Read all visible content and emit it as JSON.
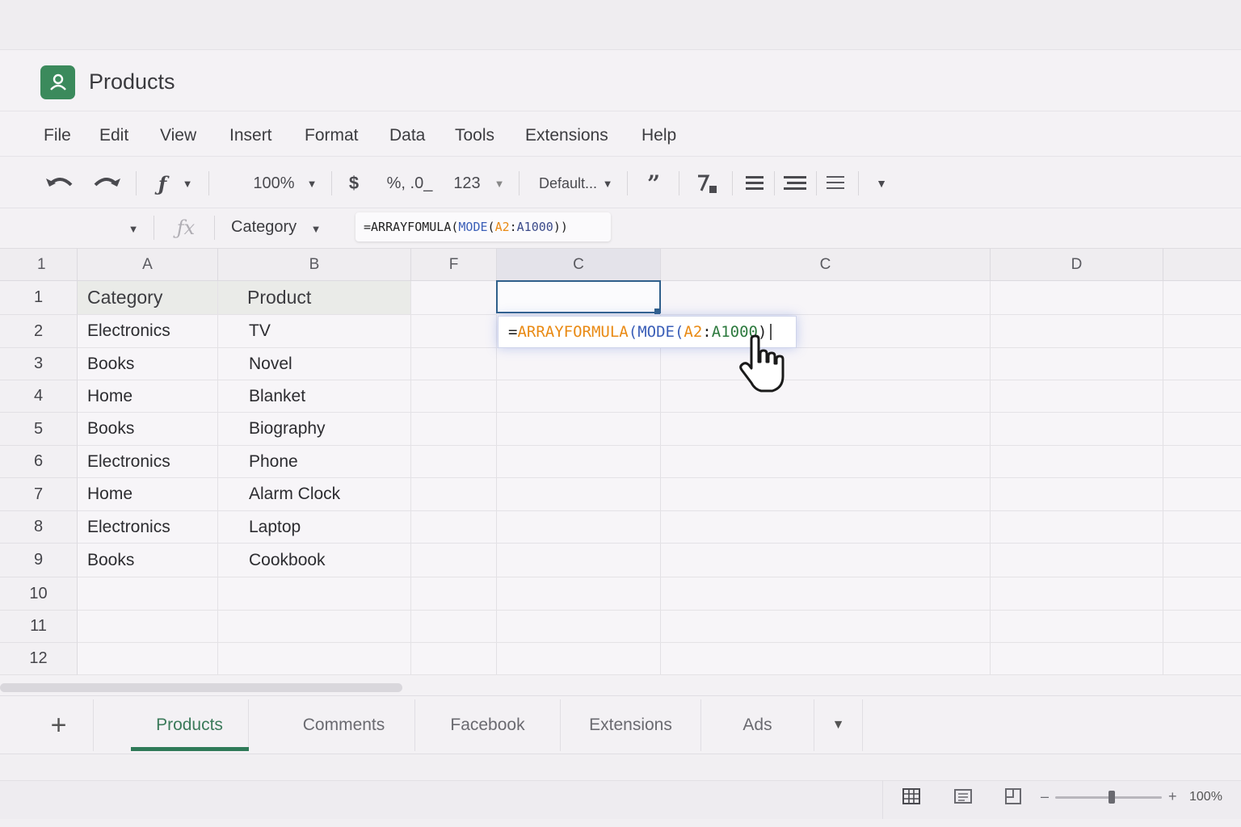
{
  "app": {
    "title": "Products"
  },
  "menu": [
    "File",
    "Edit",
    "View",
    "Insert",
    "Format",
    "Data",
    "Tools",
    "Extensions",
    "Help"
  ],
  "toolbar": {
    "zoom": "100%",
    "currency": "$",
    "percent_decimal": "%, .0_",
    "number_format": "123",
    "font": "Default..."
  },
  "formula_bar": {
    "name_box_value": "Category",
    "formula_eq": "=",
    "formula_fn": "ARRAYFOMULA",
    "formula_open": "(",
    "formula_inner_fn": "MODE",
    "formula_open2": "(",
    "formula_ref1": "A2",
    "formula_colon": ":",
    "formula_ref2": "A1000",
    "formula_close": "))"
  },
  "grid": {
    "corner_label": "1",
    "columns": [
      "A",
      "B",
      "F",
      "C",
      "C",
      "D"
    ],
    "row_numbers": [
      "1",
      "2",
      "3",
      "4",
      "5",
      "6",
      "7",
      "8",
      "9",
      "10",
      "11",
      "12"
    ],
    "rows": [
      [
        "Category",
        "Product"
      ],
      [
        "Electronics",
        "TV"
      ],
      [
        "Books",
        "Novel"
      ],
      [
        "Home",
        "Blanket"
      ],
      [
        "Books",
        "Biography"
      ],
      [
        "Electronics",
        "Phone"
      ],
      [
        "Home",
        "Alarm Clock"
      ],
      [
        "Electronics",
        "Laptop"
      ],
      [
        "Books",
        "Cookbook"
      ]
    ]
  },
  "cell_editor": {
    "eq": "=",
    "fn": "ARRAYFORMULA",
    "open": "(",
    "inner_fn": "MODE",
    "open2": "(",
    "ref1": "A2",
    "colon": ":",
    "ref2": "A1000",
    "close": ")"
  },
  "sheets": [
    "Products",
    "Comments",
    "Facebook",
    "Extensions",
    "Ads"
  ],
  "active_sheet": "Products",
  "status": {
    "zoom": "100%",
    "zoom_slider_level": 0.55
  },
  "colors": {
    "accent": "#3b8a5c",
    "selection": "#2f5f8a"
  }
}
